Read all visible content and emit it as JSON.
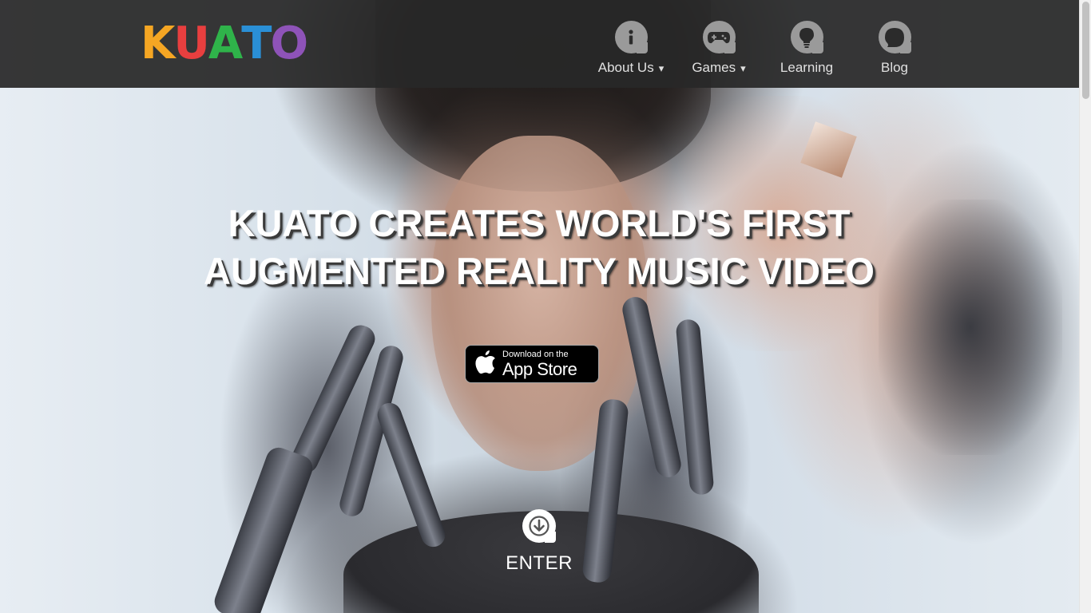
{
  "brand": {
    "logo_letters": [
      "K",
      "U",
      "A",
      "T",
      "O"
    ],
    "logo_colors": [
      "#f5a623",
      "#e83f3f",
      "#2fb34a",
      "#2a8fd6",
      "#8e53b8"
    ]
  },
  "nav": {
    "items": [
      {
        "label": "About Us",
        "icon": "info-icon",
        "dropdown": "▾"
      },
      {
        "label": "Games",
        "icon": "gamepad-icon",
        "dropdown": "▾"
      },
      {
        "label": "Learning",
        "icon": "lightbulb-icon",
        "dropdown": ""
      },
      {
        "label": "Blog",
        "icon": "chat-bubble-icon",
        "dropdown": ""
      }
    ]
  },
  "hero": {
    "headline_line1": "KUATO CREATES WORLD'S FIRST",
    "headline_line2": "AUGMENTED REALITY MUSIC VIDEO"
  },
  "appstore": {
    "small_text": "Download on the",
    "big_text": "App Store",
    "icon": "apple-icon"
  },
  "enter": {
    "label": "ENTER",
    "icon": "arrow-down-icon"
  },
  "colors": {
    "header_bg": "#282828",
    "nav_icon_bg": "#9a9a9a",
    "nav_text": "#e0e0e0"
  }
}
